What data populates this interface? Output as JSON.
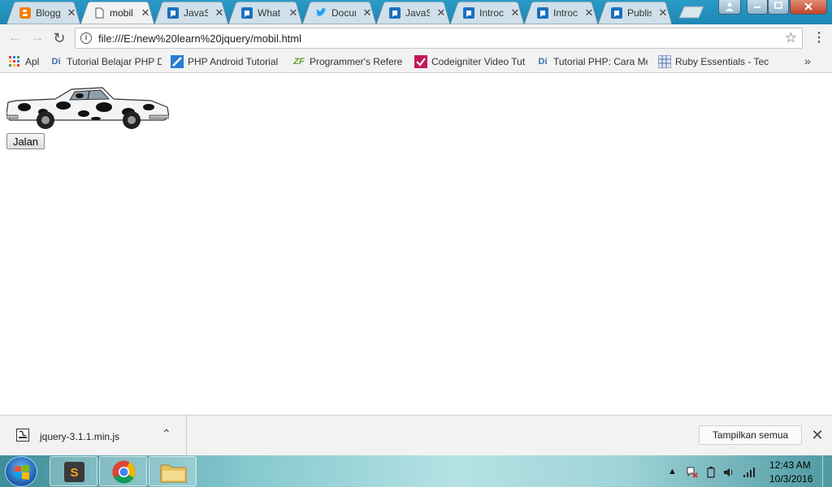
{
  "browser": {
    "tabs": [
      {
        "title": "Blogg",
        "icon": "blogger-icon",
        "active": false
      },
      {
        "title": "mobil",
        "icon": "file-icon",
        "active": true
      },
      {
        "title": "JavaS",
        "icon": "page-icon",
        "active": false
      },
      {
        "title": "What",
        "icon": "page-icon",
        "active": false
      },
      {
        "title": "Docur",
        "icon": "twitter-icon",
        "active": false
      },
      {
        "title": "JavaS",
        "icon": "page-icon",
        "active": false
      },
      {
        "title": "Introc",
        "icon": "page-icon",
        "active": false
      },
      {
        "title": "Introc",
        "icon": "page-icon",
        "active": false
      },
      {
        "title": "Publis",
        "icon": "page-icon",
        "active": false
      }
    ],
    "url": "file:///E:/new%20learn%20jquery/mobil.html",
    "bookmarks": [
      {
        "label": "Apl",
        "icon": "apps-grid-icon"
      },
      {
        "label": "Tutorial Belajar PHP D",
        "icon": "di-icon"
      },
      {
        "label": "PHP Android Tutorial",
        "icon": "blue-square-icon"
      },
      {
        "label": "Programmer's Referen",
        "icon": "zf-icon"
      },
      {
        "label": "Codeigniter Video Tut",
        "icon": "check-icon"
      },
      {
        "label": "Tutorial PHP: Cara Me",
        "icon": "di-icon"
      },
      {
        "label": "Ruby Essentials - Tech",
        "icon": "grid-icon"
      }
    ],
    "bookmarks_more": "»"
  },
  "page": {
    "button_label": "Jalan"
  },
  "downloads": {
    "filename": "jquery-3.1.1.min.js",
    "show_all": "Tampilkan semua"
  },
  "taskbar": {
    "time": "12:43 AM",
    "date": "10/3/2016"
  }
}
